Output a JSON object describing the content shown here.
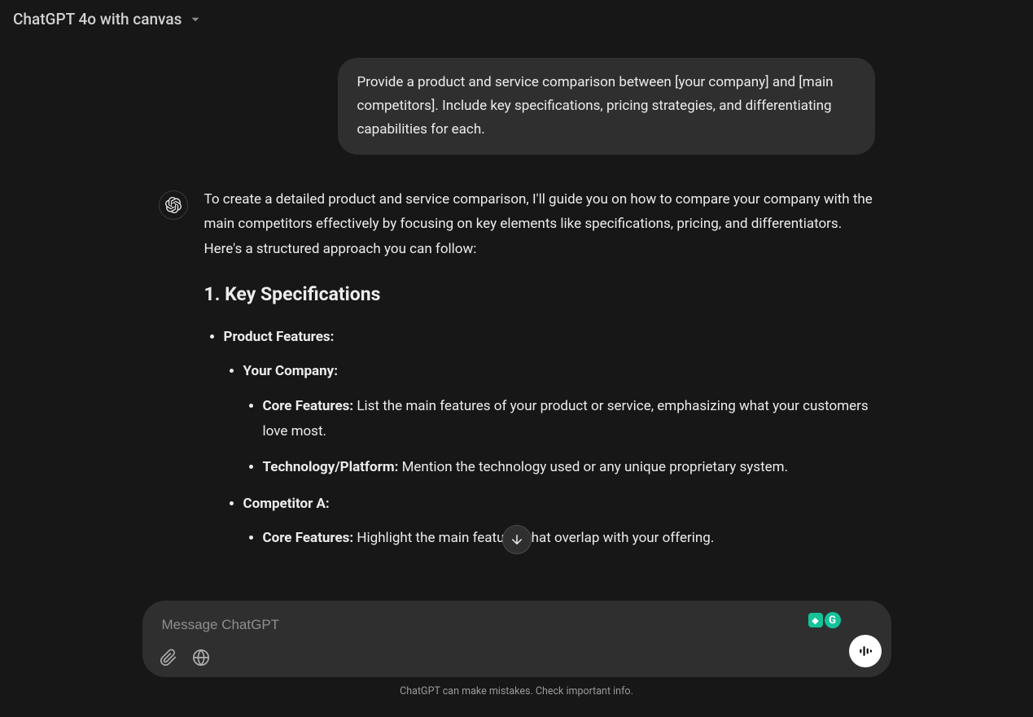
{
  "header": {
    "model_label": "ChatGPT 4o with canvas"
  },
  "conversation": {
    "user_message": "Provide a product and service comparison between [your company] and [main competitors]. Include key specifications, pricing strategies, and differentiating capabilities for each.",
    "assistant_intro": "To create a detailed product and service comparison, I'll guide you on how to compare your company with the main competitors effectively by focusing on key elements like specifications, pricing, and differentiators. Here's a structured approach you can follow:",
    "section1_heading": "1. Key Specifications",
    "bullets": {
      "product_features": "Product Features:",
      "your_company": "Your Company:",
      "core_features_label": "Core Features:",
      "core_features_text": " List the main features of your product or service, emphasizing what your customers love most.",
      "tech_label": "Technology/Platform:",
      "tech_text": " Mention the technology used or any unique proprietary system.",
      "competitor_a": "Competitor A:",
      "comp_core_label": "Core Features:",
      "comp_core_text": " Highlight the main features that overlap with your offering."
    }
  },
  "composer": {
    "placeholder": "Message ChatGPT"
  },
  "footer": {
    "disclaimer": "ChatGPT can make mistakes. Check important info."
  }
}
